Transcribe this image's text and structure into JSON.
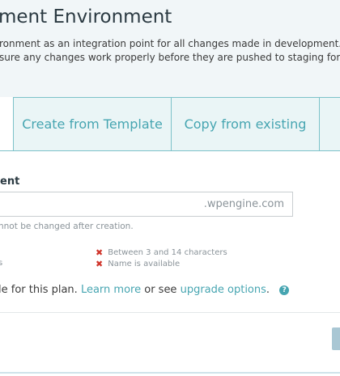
{
  "header": {
    "title": "ment Environment",
    "description_line1": "ronment as an integration point for all changes made in development. B",
    "description_line2": "sure any changes work properly before they are pushed to staging for t"
  },
  "tabs": [
    {
      "label": ""
    },
    {
      "label": "Create from Template"
    },
    {
      "label": "Copy from existing"
    },
    {
      "label": ""
    }
  ],
  "form": {
    "label": "ent",
    "input_value": "",
    "suffix": ".wpengine.com",
    "help": "nnot be changed after creation."
  },
  "requirements": [
    {
      "text": "Between 3 and 14 characters",
      "icon": "x-icon"
    },
    {
      "text": "Name is available",
      "icon": "x-icon"
    },
    {
      "text": "s"
    }
  ],
  "plan_note": {
    "prefix": "le for this plan.",
    "learn_more": "Learn more",
    "middle": "or see",
    "upgrade": "upgrade options",
    "suffix": ".",
    "help_icon": "question-icon"
  },
  "colors": {
    "accent": "#46a5b1",
    "error": "#d0352b",
    "header_bg": "#f1f6f8"
  }
}
